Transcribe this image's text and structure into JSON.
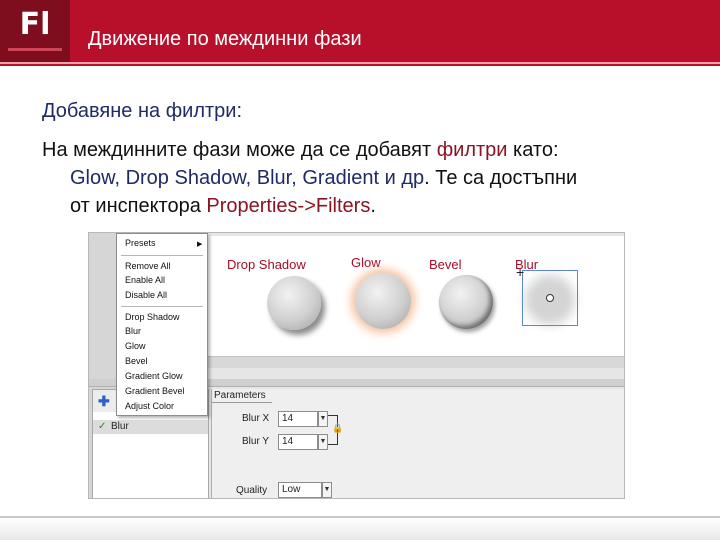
{
  "header": {
    "logo": "Fl",
    "title": "Движение по междинни фази"
  },
  "body": {
    "heading": "Добавяне на филтри:",
    "line1_a": "На междинните фази може да се добавят ",
    "line1_b": "филтри",
    "line1_c": " като:",
    "line2_a": "Glow, Drop Shadow, Blur, Gradient и др",
    "line2_b": ". Те са достъпни",
    "line3_a": "от инспектора ",
    "line3_b": "Properties->Filters",
    "line3_c": "."
  },
  "stage": {
    "labels": [
      "Drop Shadow",
      "Glow",
      "Bevel",
      "Blur"
    ]
  },
  "context_menu": {
    "items": [
      "Presets",
      "Remove All",
      "Enable All",
      "Disable All",
      "Drop Shadow",
      "Blur",
      "Glow",
      "Bevel",
      "Gradient Glow",
      "Gradient Bevel",
      "Adjust Color"
    ]
  },
  "filters_panel": {
    "active_filter": "Blur"
  },
  "parameters": {
    "tab": "Parameters",
    "blur_x_label": "Blur X",
    "blur_x_value": "14",
    "blur_y_label": "Blur Y",
    "blur_y_value": "14",
    "quality_label": "Quality",
    "quality_value": "Low"
  },
  "colors": {
    "header_red": "#b8102a",
    "logo_dark": "#7e0d1d",
    "heading_blue": "#1f2a66",
    "highlight_red": "#8a1322"
  },
  "icons": [
    "plus-icon",
    "check-icon",
    "lock-icon",
    "submenu-arrow-icon",
    "dropdown-arrow-icon"
  ]
}
